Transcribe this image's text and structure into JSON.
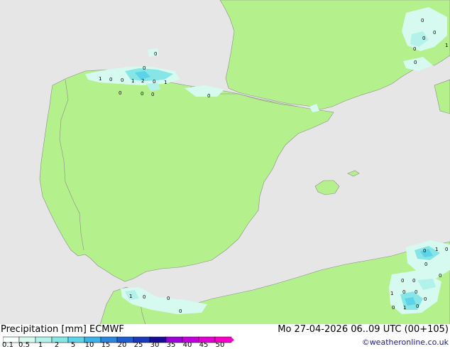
{
  "legend": {
    "title": "Precipitation [mm]",
    "model": "ECMWF",
    "ticks": [
      "0.1",
      "0.5",
      "1",
      "2",
      "5",
      "10",
      "15",
      "20",
      "25",
      "30",
      "35",
      "40",
      "45",
      "50"
    ],
    "colors": [
      "#f5fffa",
      "#d7faf0",
      "#b2f2ea",
      "#86e6e6",
      "#5cd4e8",
      "#3cb2e6",
      "#2a88dc",
      "#1e5ccf",
      "#1a3ab8",
      "#160c96",
      "#9c00d8",
      "#c000d8",
      "#e000d0",
      "#f800c8"
    ]
  },
  "datetime": "Mo 27-04-2026 06..09 UTC (00+105)",
  "credit": "©weatheronline.co.uk",
  "map": {
    "land_color": "#b4f08c",
    "sea_color": "#e6e6e6",
    "border_color": "#8c8c8c",
    "precip_labels": [
      {
        "text": "0"
      },
      {
        "text": "0"
      },
      {
        "text": "1"
      },
      {
        "text": "0"
      },
      {
        "text": "0"
      },
      {
        "text": "1"
      },
      {
        "text": "2"
      },
      {
        "text": "0"
      },
      {
        "text": "1"
      },
      {
        "text": "0"
      },
      {
        "text": "0"
      },
      {
        "text": "0"
      },
      {
        "text": "0"
      },
      {
        "text": "0"
      },
      {
        "text": "0"
      },
      {
        "text": "0"
      },
      {
        "text": "0"
      },
      {
        "text": "1"
      },
      {
        "text": "0"
      },
      {
        "text": "0"
      },
      {
        "text": "1"
      },
      {
        "text": "0"
      },
      {
        "text": "0"
      },
      {
        "text": "0"
      },
      {
        "text": "0"
      },
      {
        "text": "0"
      },
      {
        "text": "0"
      },
      {
        "text": "0"
      },
      {
        "text": "1"
      },
      {
        "text": "0"
      },
      {
        "text": "0"
      },
      {
        "text": "0"
      },
      {
        "text": "1"
      },
      {
        "text": "0"
      },
      {
        "text": "0"
      },
      {
        "text": "1"
      },
      {
        "text": "0"
      }
    ]
  }
}
